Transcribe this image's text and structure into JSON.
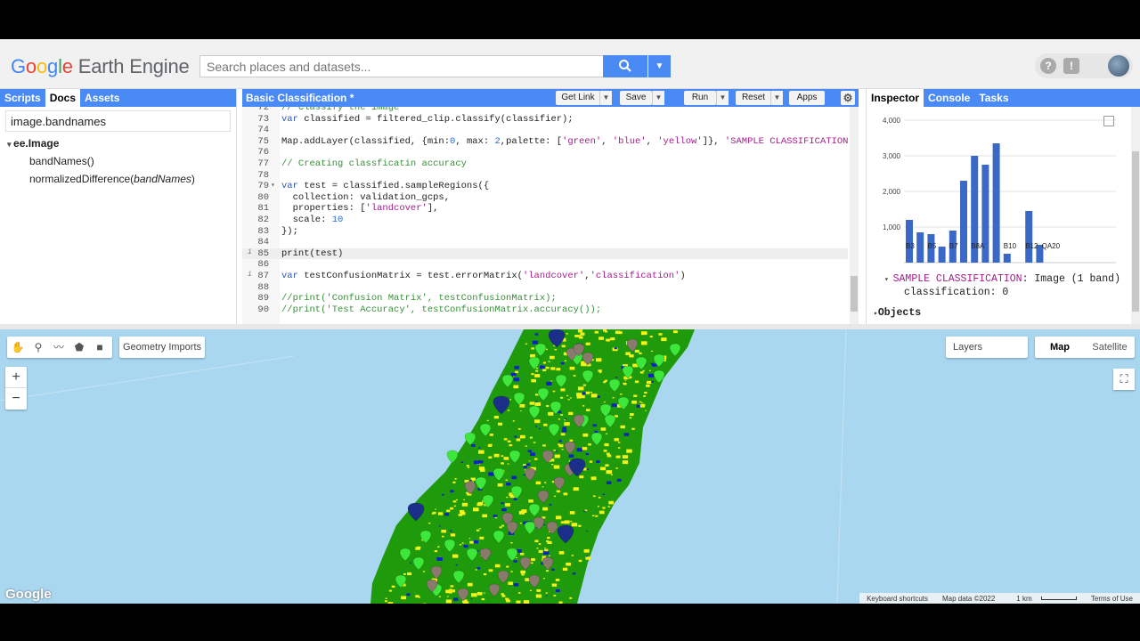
{
  "header": {
    "logo_google": "Google",
    "logo_rest": " Earth Engine",
    "search_placeholder": "Search places and datasets..."
  },
  "left_panel": {
    "tabs": [
      "Scripts",
      "Docs",
      "Assets"
    ],
    "active_tab": "Docs",
    "search_value": "image.bandnames",
    "tree_root": "ee.Image",
    "tree_items": [
      "bandNames()",
      "normalizedDifference("
    ],
    "tree_item_param": "bandNames",
    "tree_item_close": ")"
  },
  "editor": {
    "title": "Basic Classification *",
    "buttons": {
      "get_link": "Get Link",
      "save": "Save",
      "run": "Run",
      "reset": "Reset",
      "apps": "Apps"
    }
  },
  "right_panel": {
    "tabs": [
      "Inspector",
      "Console",
      "Tasks"
    ],
    "active_tab": "Inspector",
    "y_ticks": [
      "4,000",
      "3,000",
      "2,000",
      "1,000"
    ],
    "band_labels": [
      "B3",
      "B5",
      "B7",
      "B8A",
      "B10",
      "B12",
      "QA20"
    ],
    "result_name": "SAMPLE CLASSIFICATION",
    "result_type": ": Image (1 band)",
    "result_prop": "classification: 0",
    "objects": "Objects"
  },
  "chart_data": {
    "type": "bar",
    "values": [
      1200,
      850,
      800,
      450,
      900,
      2300,
      3000,
      2750,
      3350,
      250,
      0,
      1450,
      500,
      0
    ],
    "y_ticks": [
      1000,
      2000,
      3000,
      4000
    ],
    "x_labels": [
      "B3",
      "B5",
      "B7",
      "B8A",
      "B10",
      "B12",
      "QA20"
    ],
    "color": "#3a68c7"
  },
  "map": {
    "geometry_imports": "Geometry Imports",
    "layers": "Layers",
    "map_button": "Map",
    "satellite_button": "Satellite",
    "zoom_in": "+",
    "zoom_out": "−",
    "watermark": "Google",
    "attribution": [
      "Keyboard shortcuts",
      "Map data ©2022",
      "1 km",
      "Terms of Use"
    ],
    "colors": {
      "water": "#a9d7f0",
      "green": "#1e9a0a",
      "yellow": "#f5f21a",
      "blue": "#0d21c8",
      "pin_green": "#3de83a",
      "pin_gray": "#8a7a6e",
      "pin_blue": "#1b2f8a"
    }
  },
  "code_lines": [
    {
      "n": "72",
      "t": "// Classify the image",
      "cls": "c-comment",
      "partial": true
    },
    {
      "n": "73",
      "t": "var classified = filtered_clip.classify(classifier);"
    },
    {
      "n": "74",
      "t": ""
    },
    {
      "n": "75",
      "t": "Map.addLayer(classified, {min:0, max: 2,palette: ['green', 'blue', 'yellow']}, 'SAMPLE CLASSIFICATION');"
    },
    {
      "n": "76",
      "t": ""
    },
    {
      "n": "77",
      "t": "// Creating classficatin accuracy",
      "cls": "c-comment"
    },
    {
      "n": "78",
      "t": ""
    },
    {
      "n": "79",
      "t": "var test = classified.sampleRegions({"
    },
    {
      "n": "80",
      "t": "  collection: validation_gcps,"
    },
    {
      "n": "81",
      "t": "  properties: ['landcover'],"
    },
    {
      "n": "82",
      "t": "  scale: 10"
    },
    {
      "n": "83",
      "t": "});"
    },
    {
      "n": "84",
      "t": ""
    },
    {
      "n": "85",
      "t": "print(test)",
      "hl": true
    },
    {
      "n": "86",
      "t": ""
    },
    {
      "n": "87",
      "t": "var testConfusionMatrix = test.errorMatrix('landcover','classification')"
    },
    {
      "n": "88",
      "t": ""
    },
    {
      "n": "89",
      "t": "//print('Confusion Matrix', testConfusionMatrix);",
      "cls": "c-comment"
    },
    {
      "n": "90",
      "t": "//print('Test Accuracy', testConfusionMatrix.accuracy());",
      "cls": "c-comment"
    }
  ]
}
